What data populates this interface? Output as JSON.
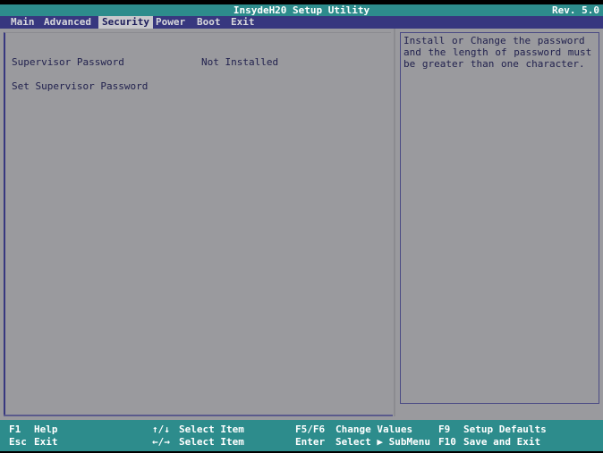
{
  "window": {
    "title": "InsydeH20 Setup Utility",
    "revision": "Rev. 5.0"
  },
  "menu": {
    "items": [
      {
        "label": "Main",
        "active": false
      },
      {
        "label": "Advanced",
        "active": false
      },
      {
        "label": "Security",
        "active": true
      },
      {
        "label": "Power",
        "active": false
      },
      {
        "label": "Boot",
        "active": false
      },
      {
        "label": "Exit",
        "active": false
      }
    ]
  },
  "settings": {
    "rows": [
      {
        "label": "Supervisor Password",
        "value": "Not Installed"
      }
    ],
    "submenu_items": [
      {
        "label": "Set Supervisor Password"
      }
    ]
  },
  "help": {
    "text": "Install or Change the password and the length of password  must be greater than one character."
  },
  "footer": {
    "columns": [
      {
        "top": {
          "key": "F1",
          "desc": "Help"
        },
        "bottom": {
          "key": "Esc",
          "desc": "Exit"
        }
      },
      {
        "top": {
          "key": "↑/↓",
          "desc": "Select Item"
        },
        "bottom": {
          "key": "←/→",
          "desc": "Select Item"
        }
      },
      {
        "top": {
          "key": "F5/F6",
          "desc": "Change Values"
        },
        "bottom": {
          "key": "Enter",
          "desc": "Select ▶ SubMenu"
        }
      },
      {
        "top": {
          "key": "F9",
          "desc": "Setup Defaults"
        },
        "bottom": {
          "key": "F10",
          "desc": "Save and Exit"
        }
      }
    ]
  },
  "colors": {
    "title_bar": "#2d8c8c",
    "menu_bar": "#37377f",
    "background": "#9a9a9e",
    "text": "#22224e",
    "footer": "#2d8c8c"
  }
}
